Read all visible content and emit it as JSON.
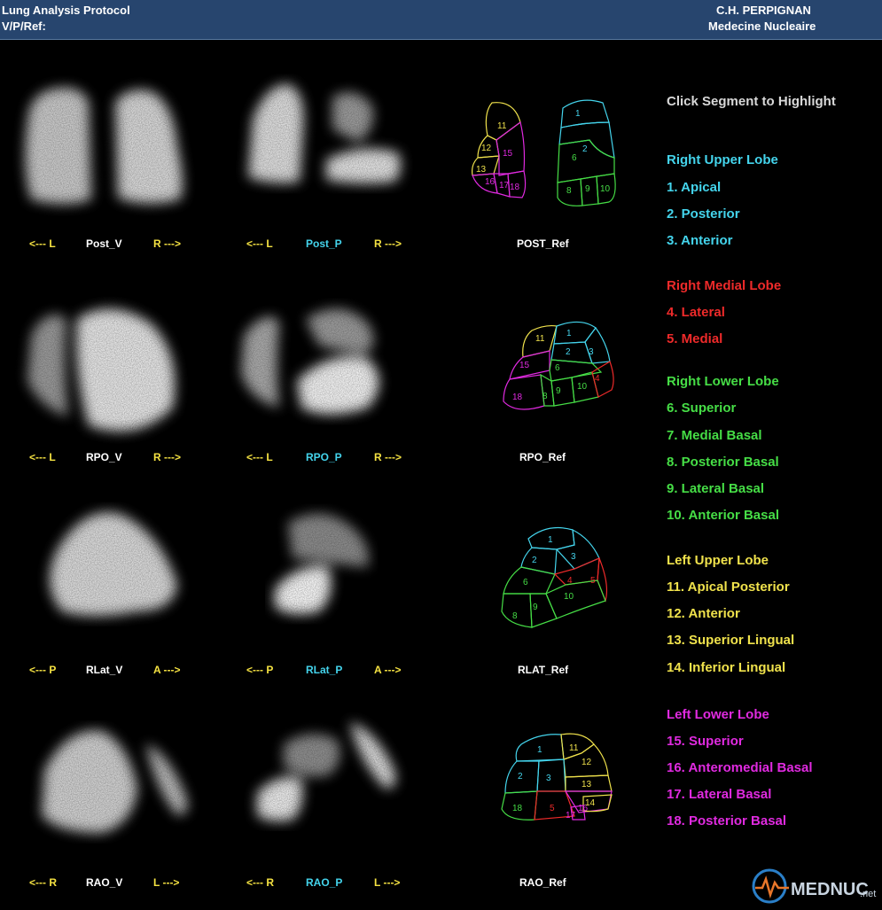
{
  "header": {
    "title": "Lung Analysis Protocol",
    "subtitle": "V/P/Ref:",
    "institution": "C.H. PERPIGNAN",
    "department": "Medecine Nucleaire"
  },
  "rows": [
    {
      "v_left": "<--- L",
      "v_name": "Post_V",
      "v_right": "R --->",
      "p_left": "<--- L",
      "p_name": "Post_P",
      "p_right": "R --->",
      "ref_name": "POST_Ref"
    },
    {
      "v_left": "<--- L",
      "v_name": "RPO_V",
      "v_right": "R --->",
      "p_left": "<--- L",
      "p_name": "RPO_P",
      "p_right": "R --->",
      "ref_name": "RPO_Ref"
    },
    {
      "v_left": "<--- P",
      "v_name": "RLat_V",
      "v_right": "A --->",
      "p_left": "<--- P",
      "p_name": "RLat_P",
      "p_right": "A --->",
      "ref_name": "RLAT_Ref"
    },
    {
      "v_left": "<--- R",
      "v_name": "RAO_V",
      "v_right": "L --->",
      "p_left": "<--- R",
      "p_name": "RAO_P",
      "p_right": "L --->",
      "ref_name": "RAO_Ref"
    }
  ],
  "legend": {
    "instruction": "Click Segment to Highlight",
    "lobes": [
      {
        "name": "Right Upper Lobe",
        "color": "#44d4ec",
        "segments": [
          "1. Apical",
          "2. Posterior",
          "3. Anterior"
        ]
      },
      {
        "name": "Right Medial Lobe",
        "color": "#ee2a2a",
        "segments": [
          "4. Lateral",
          "5. Medial"
        ]
      },
      {
        "name": "Right Lower Lobe",
        "color": "#46de46",
        "segments": [
          "6. Superior",
          "7. Medial Basal",
          "8. Posterior Basal",
          "9. Lateral Basal",
          "10. Anterior Basal"
        ]
      },
      {
        "name": "Left Upper Lobe",
        "color": "#f0e24c",
        "segments": [
          "11. Apical Posterior",
          "12. Anterior",
          "13. Superior Lingual",
          "14. Inferior Lingual"
        ]
      },
      {
        "name": "Left Lower Lobe",
        "color": "#e02ae0",
        "segments": [
          "15. Superior",
          "16. Anteromedial Basal",
          "17. Lateral Basal",
          "18. Posterior Basal"
        ]
      }
    ]
  },
  "ref_numbers": {
    "post": [
      "11",
      "12",
      "15",
      "13",
      "16",
      "17",
      "18",
      "1",
      "2",
      "6",
      "8",
      "9",
      "10"
    ],
    "rpo": [
      "11",
      "1",
      "3",
      "2",
      "15",
      "6",
      "18",
      "8",
      "9",
      "10",
      "4"
    ],
    "rlat": [
      "1",
      "2",
      "3",
      "6",
      "4",
      "5",
      "10",
      "8",
      "9"
    ],
    "rao": [
      "1",
      "11",
      "12",
      "2",
      "3",
      "13",
      "18",
      "5",
      "16",
      "14",
      "17"
    ]
  },
  "logo": {
    "text": "MEDNUC",
    "suffix": ".net"
  },
  "colors": {
    "header_bg": "#27456e",
    "cyan": "#44d4ec",
    "red": "#ee2a2a",
    "green": "#46de46",
    "yellow": "#f0e24c",
    "magenta": "#e02ae0"
  }
}
